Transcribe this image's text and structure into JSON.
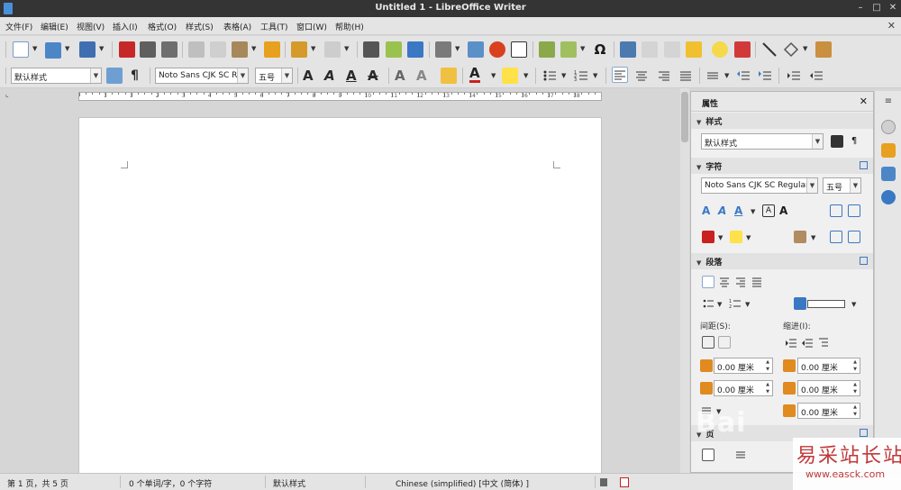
{
  "window": {
    "title": "Untitled 1 - LibreOffice Writer",
    "buttons": [
      "–",
      "□",
      "✕"
    ]
  },
  "menu": {
    "items": [
      "文件(F)",
      "编辑(E)",
      "视图(V)",
      "插入(I)",
      "格式(O)",
      "样式(S)",
      "表格(A)",
      "工具(T)",
      "窗口(W)",
      "帮助(H)"
    ],
    "close": "✕"
  },
  "formatting": {
    "paragraph_style": "默认样式",
    "font_name": "Noto Sans CJK SC Re",
    "font_size": "五号"
  },
  "sidebar": {
    "title": "属性",
    "close": "✕",
    "styles_section": {
      "label": "样式",
      "value": "默认样式"
    },
    "character_section": {
      "label": "字符",
      "font_name": "Noto Sans CJK SC Regular",
      "font_size": "五号"
    },
    "paragraph_section": {
      "label": "段落",
      "spacing_label": "间距(S):",
      "indent_label": "缩进(I):",
      "fields": [
        "0.00 厘米",
        "0.00 厘米",
        "0.00 厘米",
        "0.00 厘米",
        "0.00 厘米"
      ]
    },
    "page_section": {
      "label": "页"
    }
  },
  "ruler": {
    "numbers": [
      "1",
      "1",
      "2",
      "3",
      "4",
      "5",
      "6",
      "7",
      "8",
      "9",
      "10",
      "11",
      "12",
      "13",
      "14",
      "15",
      "16",
      "17",
      "18"
    ]
  },
  "status": {
    "page": "第 1 页，共 5 页",
    "words": "0 个单词/字，0 个字符",
    "style": "默认样式",
    "language": "Chinese (simplified) [中文 (简体) ]"
  },
  "watermark": {
    "site_name": "易采站长站",
    "site_url": "www.easck.com",
    "baidu": "Bai"
  },
  "colors": {
    "titlebar": "#343434",
    "accent": "#3b78c4",
    "watermark_red": "#c0393b"
  }
}
